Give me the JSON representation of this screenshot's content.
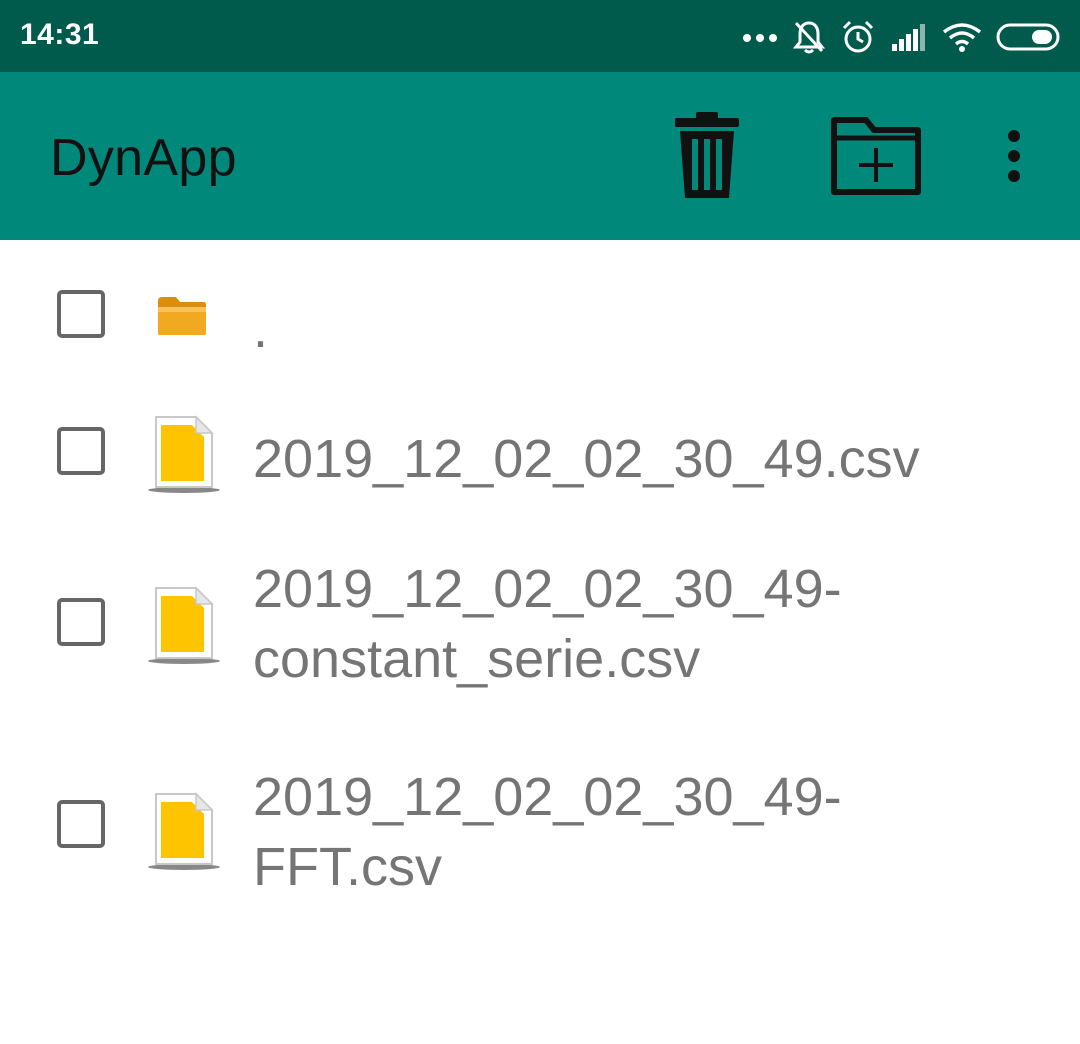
{
  "status_bar": {
    "time": "14:31",
    "icons": [
      "more-dots-icon",
      "bell-muted-icon",
      "alarm-clock-icon",
      "signal-bars-icon",
      "wifi-icon",
      "battery-icon"
    ]
  },
  "app_bar": {
    "title": "DynApp",
    "color": "#00897b",
    "actions": [
      "trash-icon",
      "new-folder-icon",
      "overflow-menu-icon"
    ]
  },
  "files": [
    {
      "name": ".",
      "type": "folder",
      "checked": false
    },
    {
      "name": "2019_12_02_02_30_49.csv",
      "type": "file",
      "checked": false
    },
    {
      "name": "2019_12_02_02_30_49-\nconstant_serie.csv",
      "type": "file",
      "checked": false
    },
    {
      "name": "2019_12_02_02_30_49-\nFFT.csv",
      "type": "file",
      "checked": false
    }
  ]
}
